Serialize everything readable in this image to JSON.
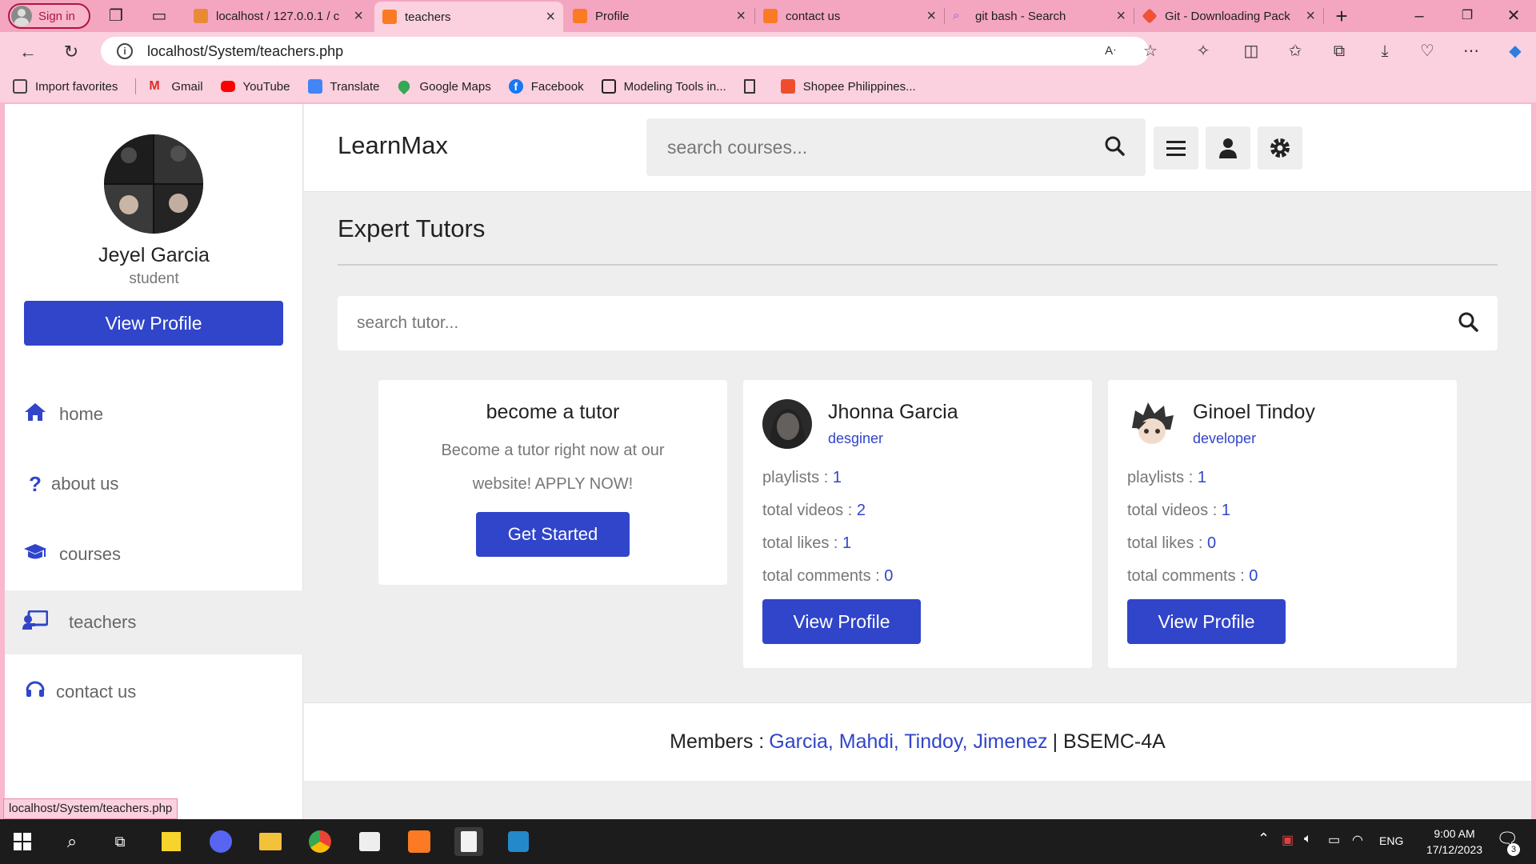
{
  "browser": {
    "sign_in": "Sign in",
    "tabs": [
      {
        "title": "localhost / 127.0.0.1 / c",
        "icon": "phpmyadmin-icon",
        "color": "#e98a35"
      },
      {
        "title": "teachers",
        "icon": "xampp-icon",
        "color": "#fb7a24",
        "active": true
      },
      {
        "title": "Profile",
        "icon": "xampp-icon",
        "color": "#fb7a24"
      },
      {
        "title": "contact us",
        "icon": "xampp-icon",
        "color": "#fb7a24"
      },
      {
        "title": "git bash - Search",
        "icon": "search-icon",
        "color": "#7b5ad6"
      },
      {
        "title": "Git - Downloading Pack",
        "icon": "git-icon",
        "color": "#f05133"
      }
    ],
    "address": "localhost/System/teachers.php",
    "bookmarks": [
      {
        "label": "Import favorites",
        "icon": "import-icon",
        "color": "#444444"
      },
      {
        "label": "Gmail",
        "icon": "gmail-icon",
        "color": "#d93025"
      },
      {
        "label": "YouTube",
        "icon": "youtube-icon",
        "color": "#ff0000"
      },
      {
        "label": "Translate",
        "icon": "translate-icon",
        "color": "#4285f4"
      },
      {
        "label": "Google Maps",
        "icon": "maps-icon",
        "color": "#34a853"
      },
      {
        "label": "Facebook",
        "icon": "facebook-icon",
        "color": "#1877f2"
      },
      {
        "label": "Modeling Tools in...",
        "icon": "modeling-icon",
        "color": "#222222"
      },
      {
        "label": "",
        "icon": "page-icon",
        "color": "#ffffff"
      },
      {
        "label": "Shopee Philippines...",
        "icon": "shopee-icon",
        "color": "#ee4d2d"
      }
    ],
    "status_url": "localhost/System/teachers.php"
  },
  "sidebar": {
    "name": "Jeyel Garcia",
    "role": "student",
    "view_profile": "View Profile",
    "nav": [
      {
        "label": "home",
        "icon": "home-icon"
      },
      {
        "label": "about us",
        "icon": "question-icon"
      },
      {
        "label": "courses",
        "icon": "graduation-cap-icon"
      },
      {
        "label": "teachers",
        "icon": "chalkboard-teacher-icon",
        "active": true
      },
      {
        "label": "contact us",
        "icon": "headset-icon"
      }
    ]
  },
  "header": {
    "logo": "LearnMax",
    "search_placeholder": "search courses..."
  },
  "main": {
    "heading": "Expert Tutors",
    "tutor_search_placeholder": "search tutor...",
    "become": {
      "title": "become a tutor",
      "text": "Become a tutor right now at our website! APPLY NOW!",
      "button": "Get Started"
    },
    "tutors": [
      {
        "name": "Jhonna Garcia",
        "role": "desginer",
        "stats": [
          {
            "label": "playlists : ",
            "value": "1"
          },
          {
            "label": "total videos : ",
            "value": "2"
          },
          {
            "label": "total likes : ",
            "value": "1"
          },
          {
            "label": "total comments : ",
            "value": "0"
          }
        ],
        "button": "View Profile"
      },
      {
        "name": "Ginoel Tindoy",
        "role": "developer",
        "stats": [
          {
            "label": "playlists : ",
            "value": "1"
          },
          {
            "label": "total videos : ",
            "value": "1"
          },
          {
            "label": "total likes : ",
            "value": "0"
          },
          {
            "label": "total comments : ",
            "value": "0"
          }
        ],
        "button": "View Profile"
      }
    ]
  },
  "footer": {
    "prefix": "Members : ",
    "members": "Garcia, Mahdi, Tindoy, Jimenez",
    "suffix": "| BSEMC-4A"
  },
  "taskbar": {
    "lang": "ENG",
    "time": "9:00 AM",
    "date": "17/12/2023",
    "notifications": "3"
  },
  "colors": {
    "accent": "#3045c9",
    "browser": "#fbd0df"
  }
}
